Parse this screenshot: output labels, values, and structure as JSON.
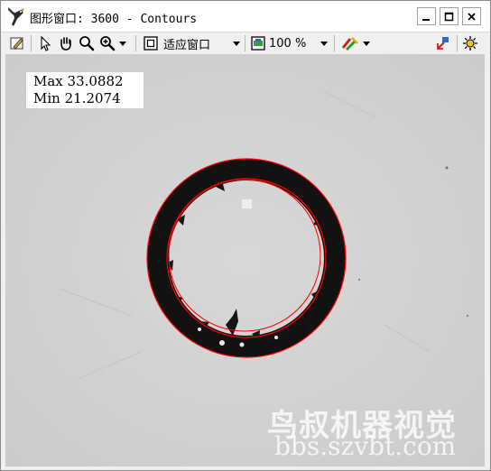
{
  "window": {
    "title": "图形窗口: 3600 - Contours",
    "controls": {
      "minimize": "minimize",
      "maximize": "maximize",
      "close": "close"
    }
  },
  "toolbar": {
    "fit_label": "适应窗口",
    "zoom_label": "100 %",
    "icons": [
      "edit-icon",
      "pointer-icon",
      "hand-icon",
      "zoom-icon",
      "zoom-in-icon",
      "fit-icon",
      "zoom-percent-icon",
      "paint-icon",
      "export-icon",
      "settings-icon"
    ]
  },
  "image": {
    "max_label": "Max 33.0882",
    "min_label": "Min 21.2074",
    "contour_color": "#ff0000",
    "ring_color": "#111111",
    "background_color": "#d2d2d2"
  },
  "watermark": {
    "line1": "鸟叔机器视觉",
    "line2": "bbs.szvbt.com"
  }
}
